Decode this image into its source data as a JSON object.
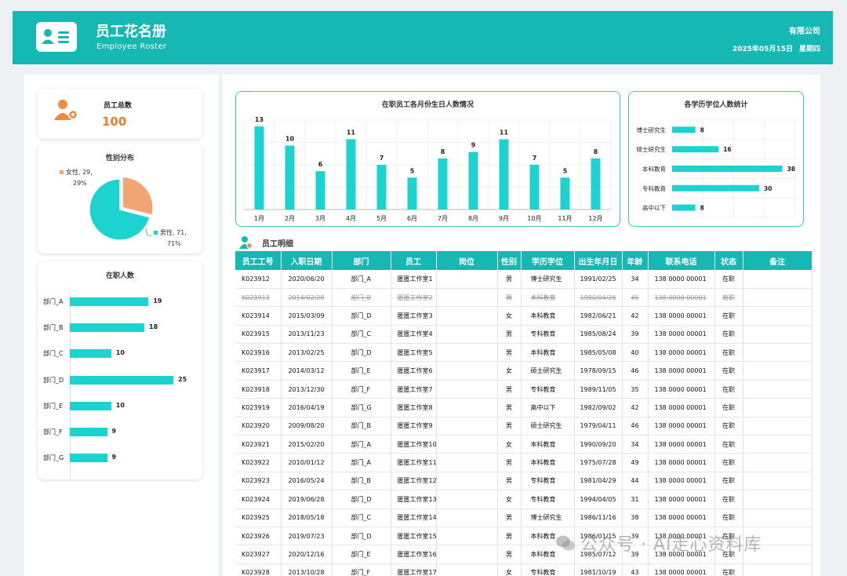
{
  "header": {
    "title": "员工花名册",
    "subtitle": "Employee Roster",
    "company": "有限公司",
    "date": "2025年05月15日",
    "weekday": "星期四",
    "accent_color": "#15b8b3"
  },
  "summary": {
    "total_label": "员工总数",
    "total_value": "100"
  },
  "gender_chart": {
    "title": "性别分布",
    "female_label": "女性, 29,",
    "female_pct": "29%",
    "male_label": "男性, 71,",
    "male_pct": "71%",
    "colors": {
      "female": "#f4a574",
      "male": "#1dd3d0"
    }
  },
  "dept_chart": {
    "title": "在职人数"
  },
  "birthday_chart": {
    "title": "在职员工各月份生日人数情况"
  },
  "degree_chart": {
    "title": "各学历学位人数统计"
  },
  "chart_data": [
    {
      "type": "pie",
      "title": "性别分布",
      "categories": [
        "女性",
        "男性"
      ],
      "values": [
        29,
        71
      ]
    },
    {
      "type": "bar",
      "orientation": "horizontal",
      "title": "在职人数",
      "categories": [
        "部门_A",
        "部门_B",
        "部门_C",
        "部门_D",
        "部门_E",
        "部门_F",
        "部门_G"
      ],
      "values": [
        19,
        18,
        10,
        25,
        10,
        9,
        9
      ],
      "xlim": [
        0,
        25
      ]
    },
    {
      "type": "bar",
      "title": "在职员工各月份生日人数情况",
      "categories": [
        "1月",
        "2月",
        "3月",
        "4月",
        "5月",
        "6月",
        "7月",
        "8月",
        "9月",
        "10月",
        "11月",
        "12月"
      ],
      "values": [
        13,
        10,
        6,
        11,
        7,
        5,
        8,
        9,
        11,
        7,
        5,
        8
      ],
      "ylim": [
        0,
        14
      ],
      "grid": true
    },
    {
      "type": "bar",
      "orientation": "horizontal",
      "title": "各学历学位人数统计",
      "categories": [
        "博士研究生",
        "硕士研究生",
        "本科教育",
        "专科教育",
        "高中以下"
      ],
      "values": [
        8,
        16,
        38,
        30,
        8
      ],
      "xlim": [
        0,
        40
      ],
      "grid": true
    }
  ],
  "detail": {
    "title": "员工明细",
    "columns": [
      "员工工号",
      "入职日期",
      "部门",
      "员工",
      "岗位",
      "性别",
      "学历学位",
      "出生年月日",
      "年龄",
      "联系电话",
      "状态",
      "备注"
    ],
    "rows": [
      {
        "id": "K023912",
        "date": "2020/06/20",
        "dept": "部门_A",
        "name": "匿匿工作室1",
        "post": "",
        "sex": "男",
        "edu": "博士研究生",
        "birth": "1991/02/25",
        "age": "34",
        "phone": "138 0000 00001",
        "status": "在职",
        "note": "",
        "struck": false
      },
      {
        "id": "K023913",
        "date": "2014/02/28",
        "dept": "部门_B",
        "name": "匿匿工作室2",
        "post": "",
        "sex": "男",
        "edu": "本科教育",
        "birth": "1980/04/26",
        "age": "45",
        "phone": "138 0000 00001",
        "status": "离职",
        "note": "",
        "struck": true
      },
      {
        "id": "K023914",
        "date": "2015/03/09",
        "dept": "部门_D",
        "name": "匿匿工作室3",
        "post": "",
        "sex": "女",
        "edu": "本科教育",
        "birth": "1982/06/21",
        "age": "42",
        "phone": "138 0000 00001",
        "status": "在职",
        "note": "",
        "struck": false
      },
      {
        "id": "K023915",
        "date": "2013/11/23",
        "dept": "部门_C",
        "name": "匿匿工作室4",
        "post": "",
        "sex": "男",
        "edu": "专科教育",
        "birth": "1985/08/24",
        "age": "39",
        "phone": "138 0000 00001",
        "status": "在职",
        "note": "",
        "struck": false
      },
      {
        "id": "K023916",
        "date": "2013/02/25",
        "dept": "部门_D",
        "name": "匿匿工作室5",
        "post": "",
        "sex": "男",
        "edu": "本科教育",
        "birth": "1985/05/08",
        "age": "40",
        "phone": "138 0000 00001",
        "status": "在职",
        "note": "",
        "struck": false
      },
      {
        "id": "K023917",
        "date": "2014/03/12",
        "dept": "部门_E",
        "name": "匿匿工作室6",
        "post": "",
        "sex": "女",
        "edu": "硕士研究生",
        "birth": "1978/09/15",
        "age": "46",
        "phone": "138 0000 00001",
        "status": "在职",
        "note": "",
        "struck": false
      },
      {
        "id": "K023918",
        "date": "2013/12/30",
        "dept": "部门_F",
        "name": "匿匿工作室7",
        "post": "",
        "sex": "男",
        "edu": "专科教育",
        "birth": "1989/11/05",
        "age": "35",
        "phone": "138 0000 00001",
        "status": "在职",
        "note": "",
        "struck": false
      },
      {
        "id": "K023919",
        "date": "2016/04/19",
        "dept": "部门_G",
        "name": "匿匿工作室8",
        "post": "",
        "sex": "男",
        "edu": "高中以下",
        "birth": "1982/09/02",
        "age": "42",
        "phone": "138 0000 00001",
        "status": "在职",
        "note": "",
        "struck": false
      },
      {
        "id": "K023920",
        "date": "2009/08/20",
        "dept": "部门_B",
        "name": "匿匿工作室9",
        "post": "",
        "sex": "男",
        "edu": "硕士研究生",
        "birth": "1979/04/11",
        "age": "46",
        "phone": "138 0000 00001",
        "status": "在职",
        "note": "",
        "struck": false
      },
      {
        "id": "K023921",
        "date": "2015/02/20",
        "dept": "部门_A",
        "name": "匿匿工作室10",
        "post": "",
        "sex": "女",
        "edu": "本科教育",
        "birth": "1990/09/20",
        "age": "34",
        "phone": "138 0000 00001",
        "status": "在职",
        "note": "",
        "struck": false
      },
      {
        "id": "K023922",
        "date": "2010/01/12",
        "dept": "部门_A",
        "name": "匿匿工作室11",
        "post": "",
        "sex": "男",
        "edu": "本科教育",
        "birth": "1975/07/28",
        "age": "49",
        "phone": "138 0000 00001",
        "status": "在职",
        "note": "",
        "struck": false
      },
      {
        "id": "K023923",
        "date": "2016/05/24",
        "dept": "部门_B",
        "name": "匿匿工作室12",
        "post": "",
        "sex": "男",
        "edu": "专科教育",
        "birth": "1981/04/29",
        "age": "44",
        "phone": "138 0000 00001",
        "status": "在职",
        "note": "",
        "struck": false
      },
      {
        "id": "K023924",
        "date": "2019/06/28",
        "dept": "部门_D",
        "name": "匿匿工作室13",
        "post": "",
        "sex": "女",
        "edu": "专科教育",
        "birth": "1994/04/05",
        "age": "31",
        "phone": "138 0000 00001",
        "status": "在职",
        "note": "",
        "struck": false
      },
      {
        "id": "K023925",
        "date": "2018/05/18",
        "dept": "部门_C",
        "name": "匿匿工作室14",
        "post": "",
        "sex": "男",
        "edu": "博士研究生",
        "birth": "1986/11/16",
        "age": "38",
        "phone": "138 0000 00001",
        "status": "在职",
        "note": "",
        "struck": false
      },
      {
        "id": "K023926",
        "date": "2019/07/23",
        "dept": "部门_D",
        "name": "匿匿工作室15",
        "post": "",
        "sex": "男",
        "edu": "本科教育",
        "birth": "1986/01/15",
        "age": "39",
        "phone": "138 0000 00001",
        "status": "在职",
        "note": "",
        "struck": false
      },
      {
        "id": "K023927",
        "date": "2020/12/16",
        "dept": "部门_E",
        "name": "匿匿工作室16",
        "post": "",
        "sex": "男",
        "edu": "本科教育",
        "birth": "1985/07/12",
        "age": "39",
        "phone": "138 0000 00001",
        "status": "在职",
        "note": "",
        "struck": false
      },
      {
        "id": "K023928",
        "date": "2013/10/28",
        "dept": "部门_F",
        "name": "匿匿工作室17",
        "post": "",
        "sex": "女",
        "edu": "专科教育",
        "birth": "1981/10/19",
        "age": "43",
        "phone": "138 0000 00001",
        "status": "在职",
        "note": "",
        "struck": false
      }
    ]
  },
  "watermark": "公众号 · AI走心资料库"
}
